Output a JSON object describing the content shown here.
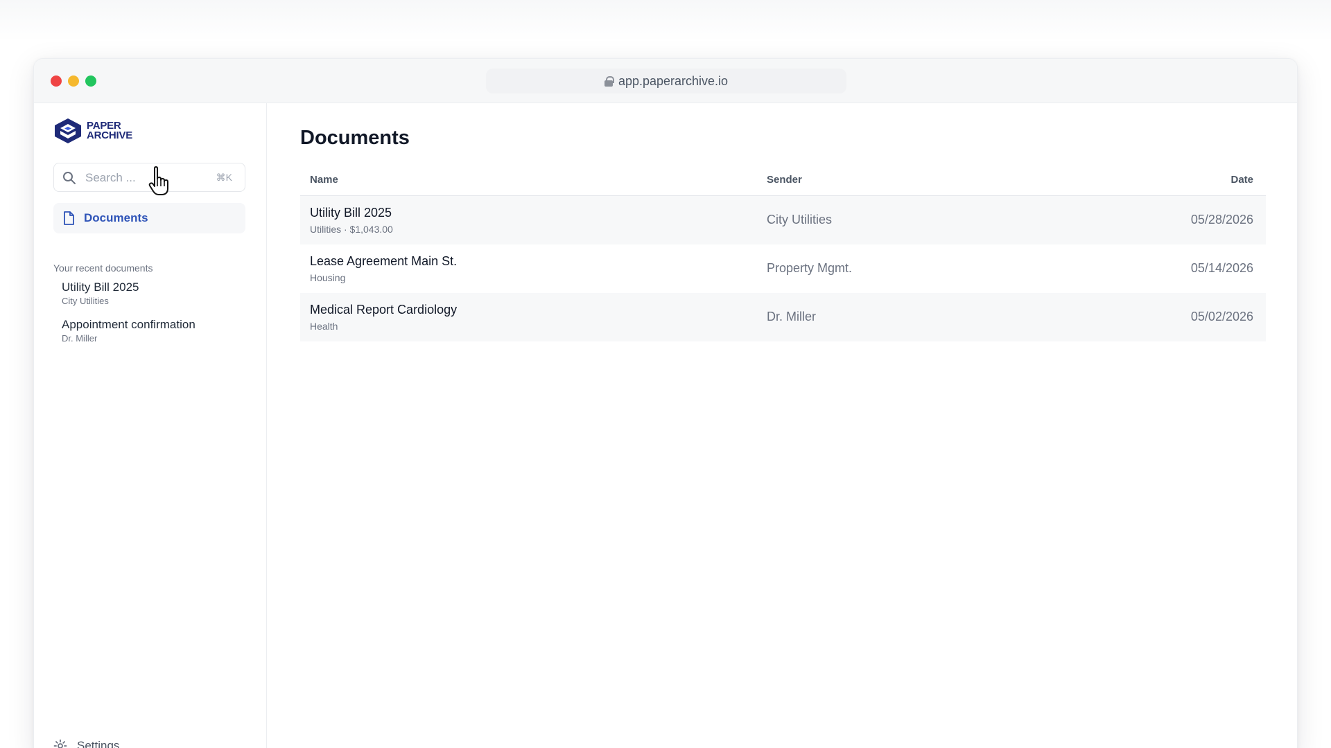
{
  "browser": {
    "url": "app.paperarchive.io"
  },
  "app": {
    "logo_line1": "PAPER",
    "logo_line2": "ARCHIVE",
    "brand_color": "#1e2a78"
  },
  "sidebar": {
    "search_placeholder": "Search ...",
    "search_shortcut": "⌘K",
    "nav_documents": "Documents",
    "recent_label": "Your recent documents",
    "recent": [
      {
        "title": "Utility Bill 2025",
        "subtitle": "City Utilities"
      },
      {
        "title": "Appointment confirmation",
        "subtitle": "Dr. Miller"
      }
    ],
    "settings_label": "Settings"
  },
  "main": {
    "title": "Documents",
    "columns": {
      "name": "Name",
      "sender": "Sender",
      "date": "Date"
    },
    "rows": [
      {
        "title": "Utility Bill 2025",
        "subtitle": "Utilities · $1,043.00",
        "sender": "City Utilities",
        "date": "05/28/2026"
      },
      {
        "title": "Lease Agreement Main St.",
        "subtitle": "Housing",
        "sender": "Property Mgmt.",
        "date": "05/14/2026"
      },
      {
        "title": "Medical Report Cardiology",
        "subtitle": "Health",
        "sender": "Dr. Miller",
        "date": "05/02/2026"
      }
    ]
  },
  "colors": {
    "accent": "#2f54b8",
    "traffic_red": "#ef4444",
    "traffic_yellow": "#f5b82e",
    "traffic_green": "#22c55e"
  }
}
